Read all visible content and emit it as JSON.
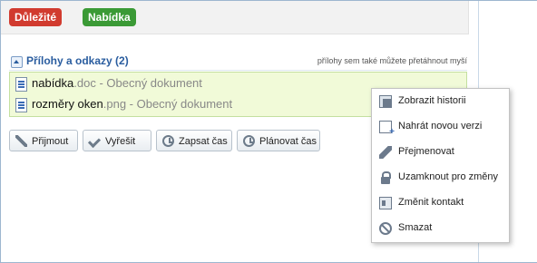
{
  "tags": [
    {
      "label": "Důležité",
      "color": "#d13b2f"
    },
    {
      "label": "Nabídka",
      "color": "#3b9a36"
    }
  ],
  "attachments": {
    "title": "Přílohy a odkazy (2)",
    "hint": "přílohy sem také můžete přetáhnout myší",
    "files": [
      {
        "name": "nabídka",
        "ext": ".doc - Obecný dokument",
        "icon": "word-document-icon"
      },
      {
        "name": "rozměry oken",
        "ext": ".png - Obecný dokument",
        "icon": "image-document-icon"
      }
    ]
  },
  "buttons": [
    {
      "label": "Přijmout",
      "icon": "accept-icon"
    },
    {
      "label": "Vyřešit",
      "icon": "check-icon"
    },
    {
      "label": "Zapsat čas",
      "icon": "clock-icon"
    },
    {
      "label": "Plánovat čas",
      "icon": "clock-icon"
    }
  ],
  "context_menu": {
    "items": [
      {
        "label": "Zobrazit historii",
        "icon": "history-icon"
      },
      {
        "label": "Nahrát novou verzi",
        "icon": "upload-version-icon"
      },
      {
        "label": "Přejmenovat",
        "icon": "pencil-icon"
      },
      {
        "label": "Uzamknout pro změny",
        "icon": "lock-icon"
      },
      {
        "label": "Změnit kontakt",
        "icon": "contact-card-icon"
      },
      {
        "label": "Smazat",
        "icon": "delete-icon"
      }
    ]
  },
  "colors": {
    "link": "#2a5d9f",
    "file_list_bg": "#f1fad8",
    "menu_border": "#c3c3c3"
  }
}
